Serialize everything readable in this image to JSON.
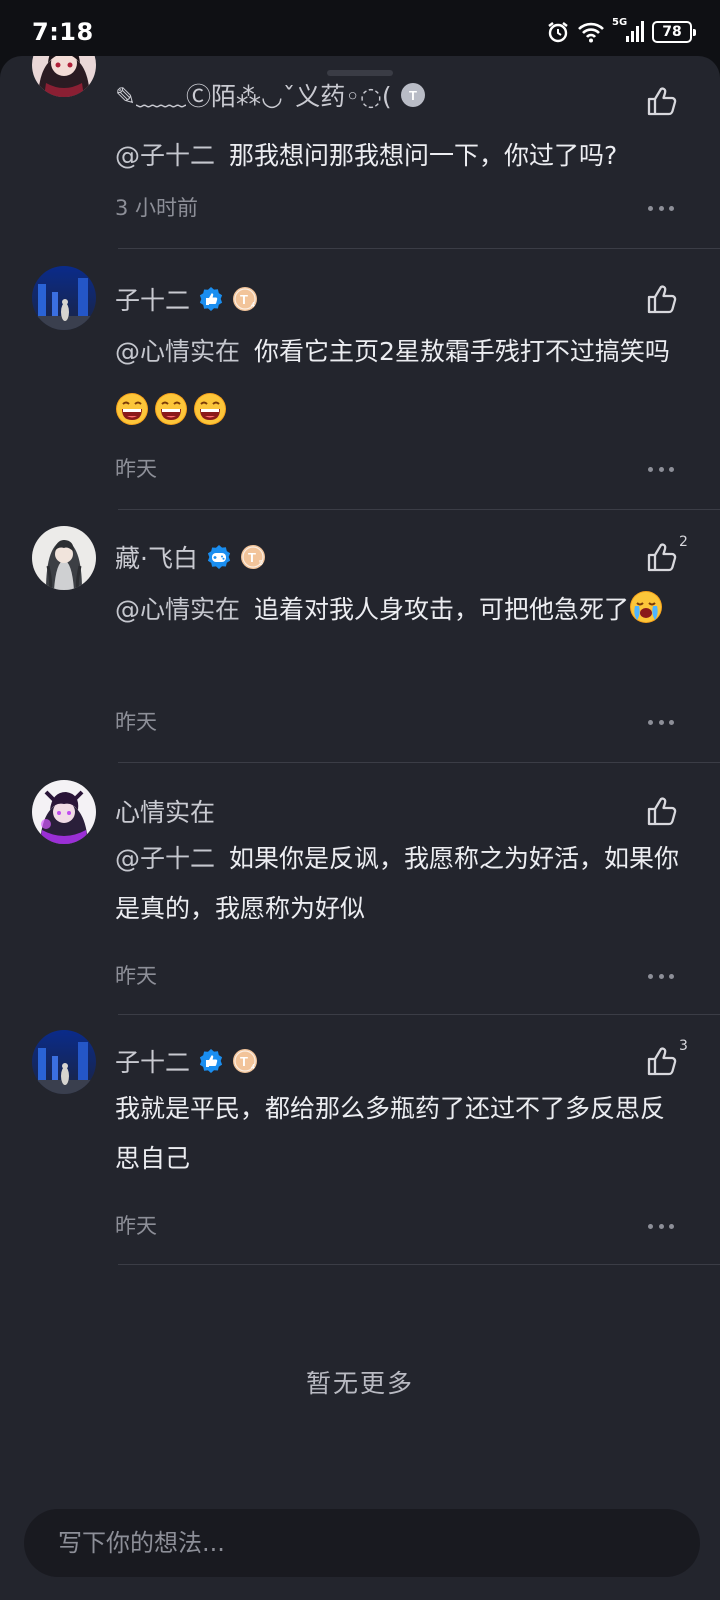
{
  "status_bar": {
    "time": "7:18",
    "network": "5G",
    "battery": "78"
  },
  "comments": [
    {
      "name": "✎﹏﹏Ⓒ陌⁂◡ˇ义药◦◌(",
      "content": "那我想问那我想问一下，你过了吗?",
      "mention": "@子十二",
      "time": "3 小时前"
    },
    {
      "name": "子十二",
      "mention": "@心情实在",
      "content": "你看它主页2星敖霜手残打不过搞笑吗",
      "time": "昨天"
    },
    {
      "name": "藏·飞白",
      "mention": "@心情实在",
      "content": "追着对我人身攻击，可把他急死了",
      "time": "昨天",
      "likes": "2"
    },
    {
      "name": "心情实在",
      "mention": "@子十二",
      "content": "如果你是反讽，我愿称之为好活，如果你是真的，我愿称为好似",
      "time": "昨天"
    },
    {
      "name": "子十二",
      "content": "我就是平民，都给那么多瓶药了还过不了多反思反思自己",
      "time": "昨天",
      "likes": "3"
    }
  ],
  "end_text": "暂无更多",
  "input": {
    "placeholder": "写下你的想法..."
  },
  "colors": {
    "background": "#23252d",
    "divider": "#3b3d46",
    "badge_blue": "#1a8ef0",
    "badge_peach": "#f2c49a"
  }
}
